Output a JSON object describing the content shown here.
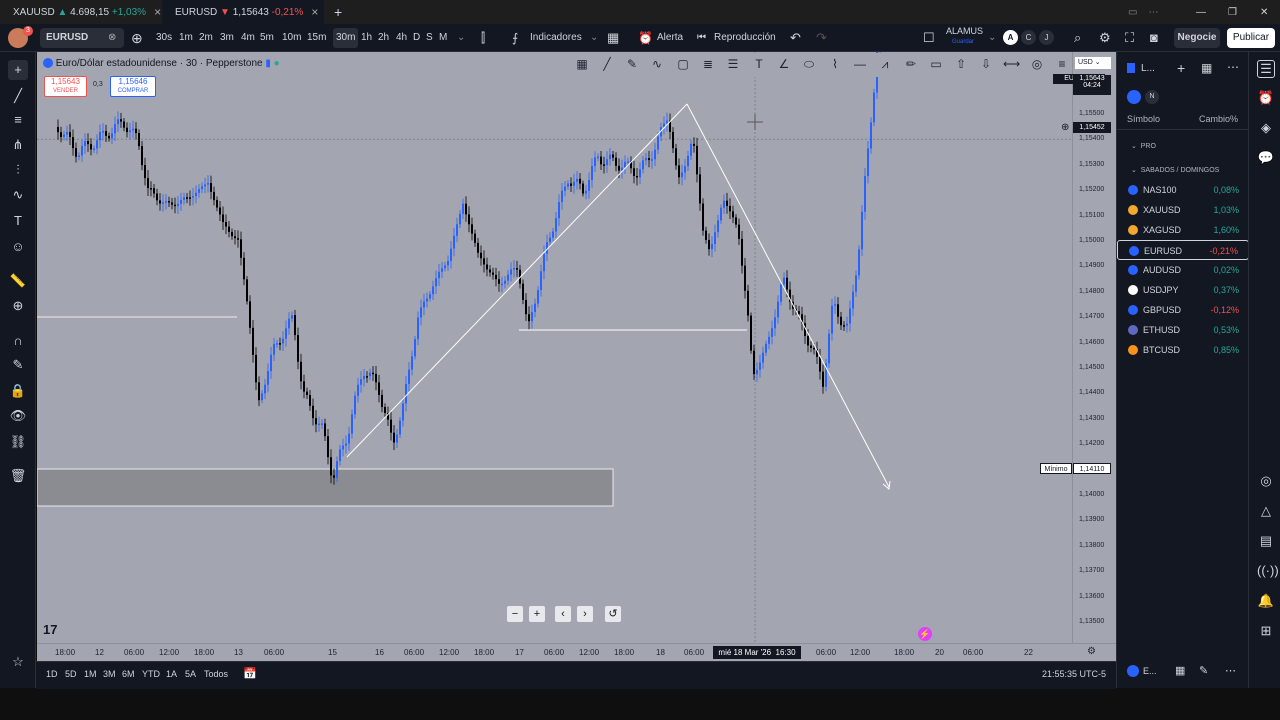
{
  "tabs": [
    {
      "symbol": "XAUUSD",
      "arrow": "▲",
      "price": "4.698,15",
      "change": "+1,03%",
      "dir": "up"
    },
    {
      "symbol": "EURUSD",
      "arrow": "▼",
      "price": "1,15643",
      "change": "-0,21%",
      "dir": "dn"
    }
  ],
  "toolbar": {
    "symbol": "EURUSD",
    "intervals": [
      "30s",
      "1m",
      "2m",
      "3m",
      "4m",
      "5m",
      "10m",
      "15m",
      "30m",
      "1h",
      "2h",
      "4h",
      "D",
      "S",
      "M"
    ],
    "active_interval": "30m",
    "indicators": "Indicadores",
    "alert": "Alerta",
    "replay": "Reproducción",
    "user_name": "ALAMUS",
    "user_sub": "Guardar",
    "user_circles": [
      "A",
      "C",
      "J"
    ],
    "trade": "Negocie",
    "publish": "Publicar",
    "avatar_badge": "3"
  },
  "chart": {
    "title": "Euro/Dólar estadounidense · 30 · Pepperstone",
    "sell_price": "1,15643",
    "sell_label": "VENDER",
    "spread": "0,3",
    "buy_price": "1,15646",
    "buy_label": "COMPRAR",
    "currency": "USD",
    "last_symbol": "EURUSD",
    "last_price": "1,15643",
    "countdown": "04:24",
    "crosshair_price": "1,15452",
    "minimum_label": "Mínimo",
    "minimum_price": "1,14110",
    "crosshair_date": "mié 18 Mar '26",
    "crosshair_time": "16:30",
    "price_levels": [
      "1,15500",
      "1,15400",
      "1,15300",
      "1,15200",
      "1,15100",
      "1,15000",
      "1,14900",
      "1,14800",
      "1,14700",
      "1,14600",
      "1,14500",
      "1,14400",
      "1,14300",
      "1,14200",
      "1,14100",
      "1,14000",
      "1,13900",
      "1,13800",
      "1,13700",
      "1,13600",
      "1,13500"
    ],
    "time_labels": [
      "18:00",
      "12",
      "06:00",
      "12:00",
      "18:00",
      "13",
      "06:00",
      "15",
      "16",
      "06:00",
      "12:00",
      "18:00",
      "17",
      "06:00",
      "12:00",
      "18:00",
      "18",
      "06:00",
      "06:00",
      "12:00",
      "18:00",
      "20",
      "06:00",
      "22"
    ]
  },
  "bottom": {
    "ranges": [
      "1D",
      "5D",
      "1M",
      "3M",
      "6M",
      "YTD",
      "1A",
      "5A",
      "Todos"
    ],
    "clock": "21:55:35 UTC-5"
  },
  "watchlist": {
    "title": "L...",
    "badge": "N",
    "col_symbol": "Símbolo",
    "col_change": "Cambio%",
    "section_pro": "PRO",
    "section_weekend": "SABADOS / DOMINGOS",
    "rows": [
      {
        "symbol": "NAS100",
        "change": "0,08%",
        "dir": "up",
        "color": "#2962ff"
      },
      {
        "symbol": "XAUUSD",
        "change": "1,03%",
        "dir": "up",
        "color": "#f0a830"
      },
      {
        "symbol": "XAGUSD",
        "change": "1,60%",
        "dir": "up",
        "color": "#f0a830"
      },
      {
        "symbol": "EURUSD",
        "change": "-0,21%",
        "dir": "dn",
        "color": "#2962ff"
      },
      {
        "symbol": "AUDUSD",
        "change": "0,02%",
        "dir": "up",
        "color": "#2962ff"
      },
      {
        "symbol": "USDJPY",
        "change": "0,37%",
        "dir": "up",
        "color": "#ffffff"
      },
      {
        "symbol": "GBPUSD",
        "change": "-0,12%",
        "dir": "dn",
        "color": "#2962ff"
      },
      {
        "symbol": "ETHUSD",
        "change": "0,53%",
        "dir": "up",
        "color": "#5c6bc0"
      },
      {
        "symbol": "BTCUSD",
        "change": "0,85%",
        "dir": "up",
        "color": "#f7931a"
      }
    ],
    "footer_label": "E..."
  },
  "colors": {
    "up": "#26a69a",
    "down": "#ef5350",
    "candle_up": "#2962ff",
    "candle_down": "#000000",
    "chart_bg": "#a3a6b0"
  }
}
